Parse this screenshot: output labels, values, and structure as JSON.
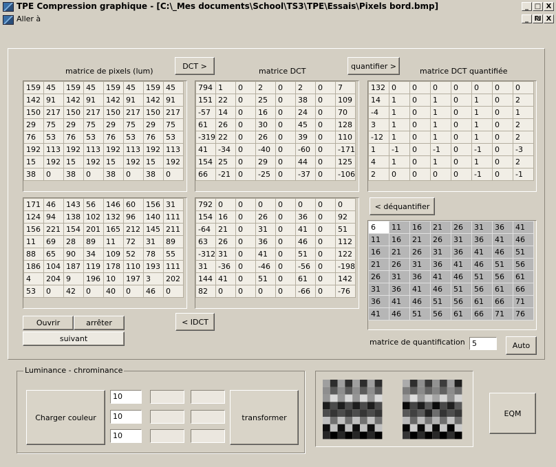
{
  "window": {
    "title": "TPE Compression graphique - [C:\\_Mes documents\\School\\TS3\\TPE\\Essais\\Pixels bord.bmp]",
    "menu_label": "Aller à",
    "buttons": {
      "minimize": "_",
      "maximize": "□",
      "close": "X",
      "restore": "₪"
    }
  },
  "labels": {
    "pixels": "matrice de pixels (lum)",
    "dct": "matrice DCT",
    "dct_quant": "matrice DCT quantifiée",
    "quant_matrix": "matrice de quantification",
    "group": "Luminance - chrominance"
  },
  "buttons": {
    "dct": "DCT >",
    "quantifier": "quantifier >",
    "idct": "< IDCT",
    "dequantifier": "< déquantifier",
    "ouvrir": "Ouvrir",
    "arreter": "arrêter",
    "suivant": "suivant",
    "auto": "Auto",
    "charger": "Charger couleur",
    "transformer": "transformer",
    "eqm": "EQM"
  },
  "quant_factor": "5",
  "ycc_fields": [
    "10",
    "10",
    "10"
  ],
  "matrices": {
    "pixels": [
      [
        "159",
        "45",
        "159",
        "45",
        "159",
        "45",
        "159",
        "45"
      ],
      [
        "142",
        "91",
        "142",
        "91",
        "142",
        "91",
        "142",
        "91"
      ],
      [
        "150",
        "217",
        "150",
        "217",
        "150",
        "217",
        "150",
        "217"
      ],
      [
        "29",
        "75",
        "29",
        "75",
        "29",
        "75",
        "29",
        "75"
      ],
      [
        "76",
        "53",
        "76",
        "53",
        "76",
        "53",
        "76",
        "53"
      ],
      [
        "192",
        "113",
        "192",
        "113",
        "192",
        "113",
        "192",
        "113"
      ],
      [
        "15",
        "192",
        "15",
        "192",
        "15",
        "192",
        "15",
        "192"
      ],
      [
        "38",
        "0",
        "38",
        "0",
        "38",
        "0",
        "38",
        "0"
      ]
    ],
    "dct": [
      [
        "794",
        "1",
        "0",
        "2",
        "0",
        "2",
        "0",
        "7"
      ],
      [
        "151",
        "22",
        "0",
        "25",
        "0",
        "38",
        "0",
        "109"
      ],
      [
        "-57",
        "14",
        "0",
        "16",
        "0",
        "24",
        "0",
        "70"
      ],
      [
        "61",
        "26",
        "0",
        "30",
        "0",
        "45",
        "0",
        "128"
      ],
      [
        "-319",
        "22",
        "0",
        "26",
        "0",
        "39",
        "0",
        "110"
      ],
      [
        "41",
        "-34",
        "0",
        "-40",
        "0",
        "-60",
        "0",
        "-171"
      ],
      [
        "154",
        "25",
        "0",
        "29",
        "0",
        "44",
        "0",
        "125"
      ],
      [
        "66",
        "-21",
        "0",
        "-25",
        "0",
        "-37",
        "0",
        "-106"
      ]
    ],
    "dct_quant": [
      [
        "132",
        "0",
        "0",
        "0",
        "0",
        "0",
        "0",
        "0"
      ],
      [
        "14",
        "1",
        "0",
        "1",
        "0",
        "1",
        "0",
        "2"
      ],
      [
        "-4",
        "1",
        "0",
        "1",
        "0",
        "1",
        "0",
        "1"
      ],
      [
        "3",
        "1",
        "0",
        "1",
        "0",
        "1",
        "0",
        "2"
      ],
      [
        "-12",
        "1",
        "0",
        "1",
        "0",
        "1",
        "0",
        "2"
      ],
      [
        "1",
        "-1",
        "0",
        "-1",
        "0",
        "-1",
        "0",
        "-3"
      ],
      [
        "4",
        "1",
        "0",
        "1",
        "0",
        "1",
        "0",
        "2"
      ],
      [
        "2",
        "0",
        "0",
        "0",
        "0",
        "-1",
        "0",
        "-1"
      ]
    ],
    "pixels_rebuilt": [
      [
        "171",
        "46",
        "143",
        "56",
        "146",
        "60",
        "156",
        "31"
      ],
      [
        "124",
        "94",
        "138",
        "102",
        "132",
        "96",
        "140",
        "111"
      ],
      [
        "156",
        "221",
        "154",
        "201",
        "165",
        "212",
        "145",
        "211"
      ],
      [
        "11",
        "69",
        "28",
        "89",
        "11",
        "72",
        "31",
        "89"
      ],
      [
        "88",
        "65",
        "90",
        "34",
        "109",
        "52",
        "78",
        "55"
      ],
      [
        "186",
        "104",
        "187",
        "119",
        "178",
        "110",
        "193",
        "111"
      ],
      [
        "4",
        "204",
        "9",
        "196",
        "10",
        "197",
        "3",
        "202"
      ],
      [
        "53",
        "0",
        "42",
        "0",
        "40",
        "0",
        "46",
        "0"
      ]
    ],
    "dct_dequant": [
      [
        "792",
        "0",
        "0",
        "0",
        "0",
        "0",
        "0",
        "0"
      ],
      [
        "154",
        "16",
        "0",
        "26",
        "0",
        "36",
        "0",
        "92"
      ],
      [
        "-64",
        "21",
        "0",
        "31",
        "0",
        "41",
        "0",
        "51"
      ],
      [
        "63",
        "26",
        "0",
        "36",
        "0",
        "46",
        "0",
        "112"
      ],
      [
        "-312",
        "31",
        "0",
        "41",
        "0",
        "51",
        "0",
        "122"
      ],
      [
        "31",
        "-36",
        "0",
        "-46",
        "0",
        "-56",
        "0",
        "-198"
      ],
      [
        "144",
        "41",
        "0",
        "51",
        "0",
        "61",
        "0",
        "142"
      ],
      [
        "82",
        "0",
        "0",
        "0",
        "0",
        "-66",
        "0",
        "-76"
      ]
    ],
    "quantification": [
      [
        "6",
        "11",
        "16",
        "21",
        "26",
        "31",
        "36",
        "41"
      ],
      [
        "11",
        "16",
        "21",
        "26",
        "31",
        "36",
        "41",
        "46"
      ],
      [
        "16",
        "21",
        "26",
        "31",
        "36",
        "41",
        "46",
        "51"
      ],
      [
        "21",
        "26",
        "31",
        "36",
        "41",
        "46",
        "51",
        "56"
      ],
      [
        "26",
        "31",
        "36",
        "41",
        "46",
        "51",
        "56",
        "61"
      ],
      [
        "31",
        "36",
        "41",
        "46",
        "51",
        "56",
        "61",
        "66"
      ],
      [
        "36",
        "41",
        "46",
        "51",
        "56",
        "61",
        "66",
        "71"
      ],
      [
        "41",
        "46",
        "51",
        "56",
        "61",
        "66",
        "71",
        "76"
      ]
    ]
  }
}
